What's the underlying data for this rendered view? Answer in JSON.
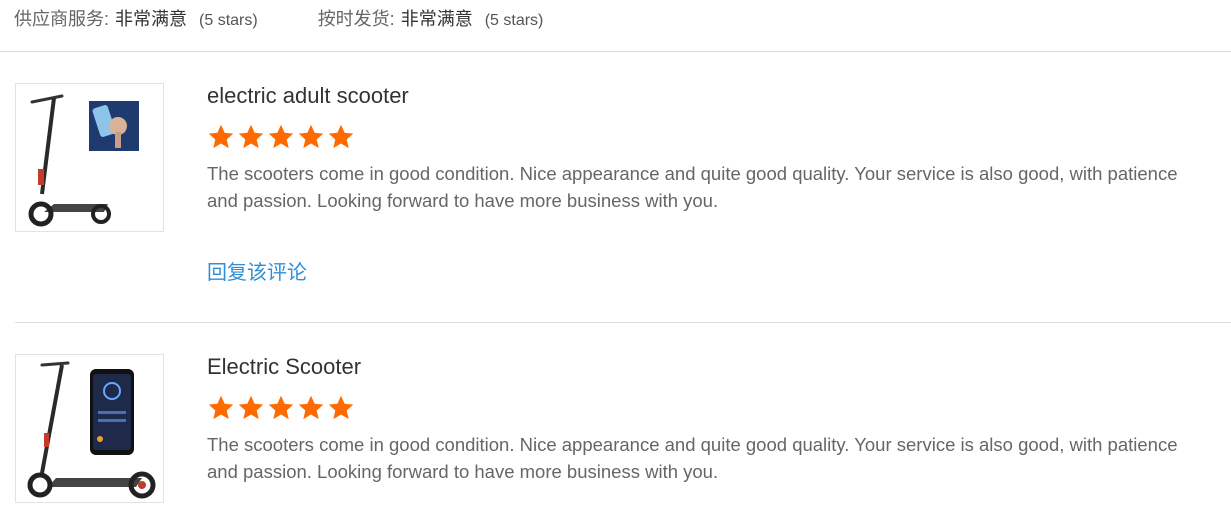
{
  "summary": {
    "supplier_service": {
      "label": "供应商服务:",
      "value": "非常满意",
      "stars": "(5 stars)"
    },
    "on_time_shipping": {
      "label": "按时发货:",
      "value": "非常满意",
      "stars": "(5 stars)"
    }
  },
  "reviews": [
    {
      "title": "electric adult scooter",
      "rating": 5,
      "comment": "The scooters come in good condition. Nice appearance and quite good quality. Your service is also good, with patience and passion. Looking forward to have more business with you.",
      "reply_label": "回复该评论"
    },
    {
      "title": "Electric Scooter",
      "rating": 5,
      "comment": "The scooters come in good condition. Nice appearance and quite good quality. Your service is also good, with patience and passion. Looking forward to have more business with you."
    }
  ],
  "colors": {
    "star": "#ff6a00",
    "link": "#2f8fd6",
    "divider": "#dcdcdc"
  }
}
